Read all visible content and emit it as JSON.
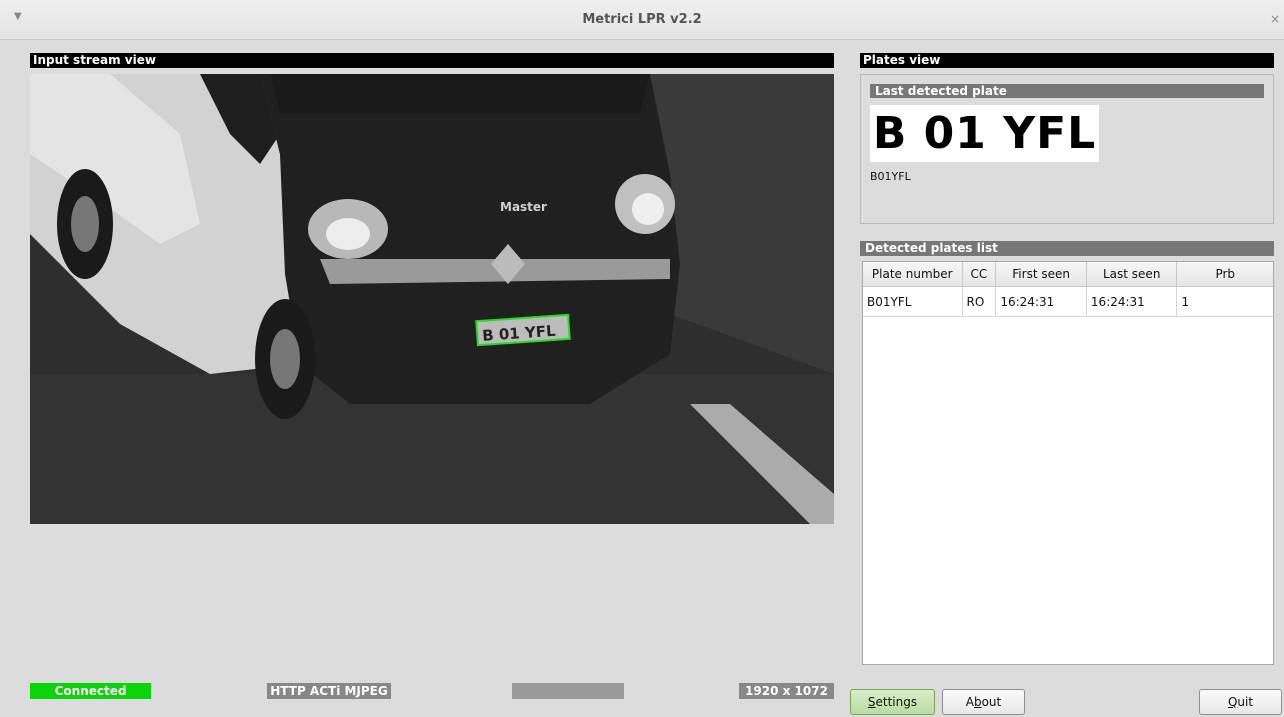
{
  "window": {
    "title": "Metrici LPR v2.2",
    "menu_icon": "chevron-down-icon",
    "close_icon": "close-icon"
  },
  "input_stream": {
    "header": "Input stream view",
    "detected_plate_overlay": "B 01 YFL",
    "vehicle_badge": "Master"
  },
  "status_bar": {
    "connected": "Connected",
    "stream_type": "HTTP ACTi MJPEG",
    "address": "",
    "resolution": "1920 x 1072",
    "colors": {
      "connected": "#0bd40b",
      "label_bg": "#888888"
    }
  },
  "plates_view": {
    "header": "Plates view",
    "last_detected_header": "Last detected plate",
    "plate_image_text": "B 01 YFL",
    "plate_text": "B01YFL"
  },
  "plates_list": {
    "header": "Detected plates list",
    "columns": [
      "Plate number",
      "CC",
      "First seen",
      "Last seen",
      "Prb"
    ],
    "rows": [
      {
        "plate": "B01YFL",
        "cc": "RO",
        "first_seen": "16:24:31",
        "last_seen": "16:24:31",
        "prb": "1"
      }
    ]
  },
  "buttons": {
    "settings_pre": "",
    "settings_ul": "S",
    "settings_post": "ettings",
    "about_pre": "A",
    "about_ul": "b",
    "about_post": "out",
    "quit_pre": "",
    "quit_ul": "Q",
    "quit_post": "uit"
  }
}
